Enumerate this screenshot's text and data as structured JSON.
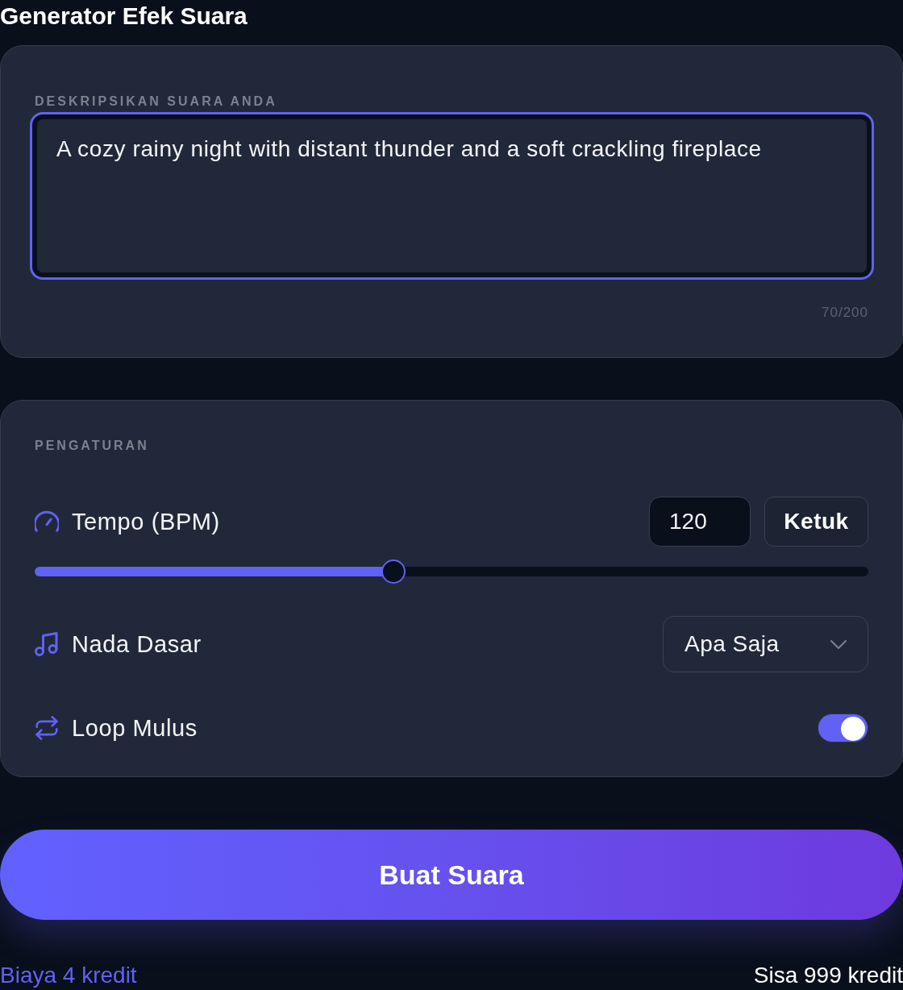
{
  "title": "Generator Efek Suara",
  "description": {
    "label": "DESKRIPSIKAN SUARA ANDA",
    "value": "A cozy rainy night with distant thunder and a soft crackling fireplace",
    "counter": "70/200",
    "focused": true
  },
  "settings": {
    "label": "PENGATURAN",
    "rows": [
      {
        "kind": "tempo",
        "label": "Tempo (BPM)",
        "value": "120",
        "button": "Ketuk",
        "level": 0.43
      },
      {
        "kind": "select",
        "label": "Nada Dasar",
        "value": "Apa Saja"
      },
      {
        "kind": "toggle",
        "label": "Loop Mulus",
        "on": true
      }
    ]
  },
  "generate_button": "Buat Suara",
  "footer": {
    "cost": "Biaya 4 kredit",
    "balance": "Sisa 999 kredit"
  }
}
